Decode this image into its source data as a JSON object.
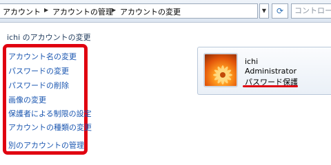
{
  "address_bar": {
    "breadcrumbs": [
      "アカウント",
      "アカウントの管理",
      "アカウントの変更"
    ],
    "search_placeholder": "コントロー"
  },
  "left_pane": {
    "title": "ichi のアカウントの変更",
    "tasks": [
      "アカウント名の変更",
      "パスワードの変更",
      "パスワードの削除",
      "画像の変更",
      "保護者による制限の設定",
      "アカウントの種類の変更",
      "別のアカウントの管理"
    ]
  },
  "account": {
    "name": "ichi",
    "type": "Administrator",
    "status": "パスワード保護"
  },
  "colors": {
    "highlight": "#e00010",
    "link": "#1a56b0"
  }
}
